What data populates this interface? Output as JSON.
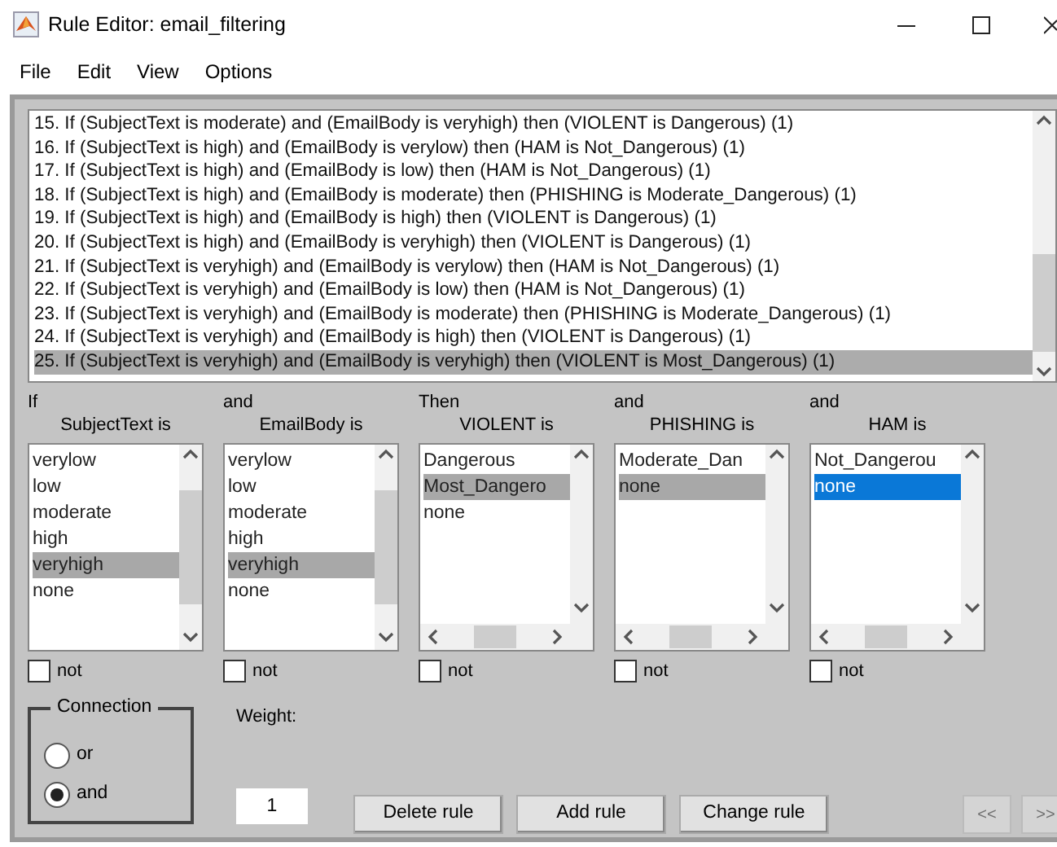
{
  "window": {
    "title": "Rule Editor: email_filtering"
  },
  "menu": [
    "File",
    "Edit",
    "View",
    "Options"
  ],
  "rules": [
    {
      "text": "15. If (SubjectText is moderate) and (EmailBody is veryhigh) then (VIOLENT is Dangerous) (1)",
      "selected": false
    },
    {
      "text": "16. If (SubjectText is high) and (EmailBody is verylow) then (HAM is Not_Dangerous) (1)",
      "selected": false
    },
    {
      "text": "17. If (SubjectText is high) and (EmailBody is low) then (HAM is Not_Dangerous) (1)",
      "selected": false
    },
    {
      "text": "18. If (SubjectText is high) and (EmailBody is moderate) then (PHISHING is Moderate_Dangerous) (1)",
      "selected": false
    },
    {
      "text": "19. If (SubjectText is high) and (EmailBody is high) then (VIOLENT is Dangerous) (1)",
      "selected": false
    },
    {
      "text": "20. If (SubjectText is high) and (EmailBody is veryhigh) then (VIOLENT is Dangerous) (1)",
      "selected": false
    },
    {
      "text": "21. If (SubjectText is veryhigh) and (EmailBody is verylow) then (HAM is Not_Dangerous) (1)",
      "selected": false
    },
    {
      "text": "22. If (SubjectText is veryhigh) and (EmailBody is low) then (HAM is Not_Dangerous) (1)",
      "selected": false
    },
    {
      "text": "23. If (SubjectText is veryhigh) and (EmailBody is moderate) then (PHISHING is Moderate_Dangerous) (1)",
      "selected": false
    },
    {
      "text": "24. If (SubjectText is veryhigh) and (EmailBody is high) then (VIOLENT is Dangerous) (1)",
      "selected": false
    },
    {
      "text": "25. If (SubjectText is veryhigh) and (EmailBody is veryhigh) then (VIOLENT is Most_Dangerous) (1)",
      "selected": true
    }
  ],
  "columns": [
    {
      "connector": "If",
      "label": "SubjectText is",
      "kind": "input",
      "focused": false,
      "not_label": "not",
      "not_checked": false,
      "options": [
        {
          "text": "verylow",
          "selected": false
        },
        {
          "text": "low",
          "selected": false
        },
        {
          "text": "moderate",
          "selected": false
        },
        {
          "text": "high",
          "selected": false
        },
        {
          "text": "veryhigh",
          "selected": true
        },
        {
          "text": "none",
          "selected": false
        }
      ]
    },
    {
      "connector": "and",
      "label": "EmailBody is",
      "kind": "input",
      "focused": false,
      "not_label": "not",
      "not_checked": false,
      "options": [
        {
          "text": "verylow",
          "selected": false
        },
        {
          "text": "low",
          "selected": false
        },
        {
          "text": "moderate",
          "selected": false
        },
        {
          "text": "high",
          "selected": false
        },
        {
          "text": "veryhigh",
          "selected": true
        },
        {
          "text": "none",
          "selected": false
        }
      ]
    },
    {
      "connector": "Then",
      "label": "VIOLENT is",
      "kind": "output",
      "focused": false,
      "not_label": "not",
      "not_checked": false,
      "options": [
        {
          "text": "Dangerous",
          "selected": false
        },
        {
          "text": "Most_Dangero",
          "selected": true
        },
        {
          "text": "none",
          "selected": false
        }
      ]
    },
    {
      "connector": "and",
      "label": "PHISHING is",
      "kind": "output",
      "focused": false,
      "not_label": "not",
      "not_checked": false,
      "options": [
        {
          "text": "Moderate_Dan",
          "selected": false
        },
        {
          "text": "none",
          "selected": true
        }
      ]
    },
    {
      "connector": "and",
      "label": "HAM is",
      "kind": "output",
      "focused": true,
      "not_label": "not",
      "not_checked": false,
      "options": [
        {
          "text": "Not_Dangerou",
          "selected": false
        },
        {
          "text": "none",
          "selected": true
        }
      ]
    }
  ],
  "connection": {
    "label": "Connection",
    "options": [
      {
        "label": "or",
        "selected": false
      },
      {
        "label": "and",
        "selected": true
      }
    ]
  },
  "weight": {
    "label": "Weight:",
    "value": "1"
  },
  "buttons": [
    {
      "label": "Delete rule",
      "disabled": false
    },
    {
      "label": "Add rule",
      "disabled": false
    },
    {
      "label": "Change rule",
      "disabled": false
    }
  ],
  "nav_buttons": [
    {
      "label": "<<",
      "disabled": true
    },
    {
      "label": ">>",
      "disabled": true
    }
  ]
}
